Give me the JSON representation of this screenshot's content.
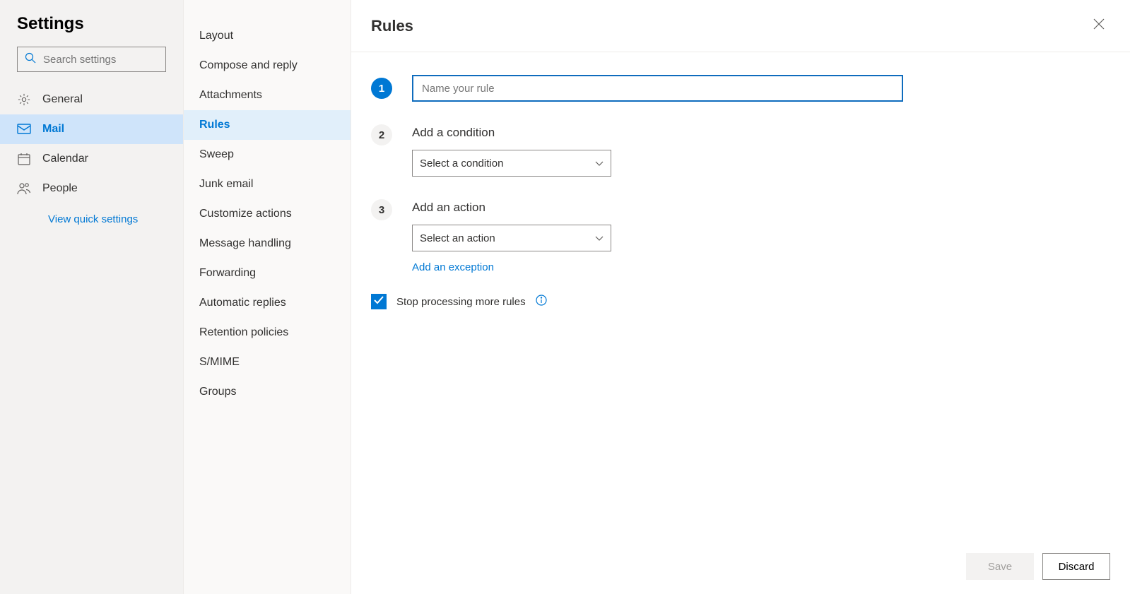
{
  "sidebar": {
    "title": "Settings",
    "search_placeholder": "Search settings",
    "items": [
      {
        "label": "General"
      },
      {
        "label": "Mail"
      },
      {
        "label": "Calendar"
      },
      {
        "label": "People"
      }
    ],
    "quick_link": "View quick settings"
  },
  "midbar": {
    "items": [
      {
        "label": "Layout"
      },
      {
        "label": "Compose and reply"
      },
      {
        "label": "Attachments"
      },
      {
        "label": "Rules"
      },
      {
        "label": "Sweep"
      },
      {
        "label": "Junk email"
      },
      {
        "label": "Customize actions"
      },
      {
        "label": "Message handling"
      },
      {
        "label": "Forwarding"
      },
      {
        "label": "Automatic replies"
      },
      {
        "label": "Retention policies"
      },
      {
        "label": "S/MIME"
      },
      {
        "label": "Groups"
      }
    ],
    "selected_index": 3
  },
  "main": {
    "title": "Rules",
    "steps": {
      "one": {
        "num": "1",
        "input_placeholder": "Name your rule",
        "input_value": ""
      },
      "two": {
        "num": "2",
        "title": "Add a condition",
        "dropdown": "Select a condition"
      },
      "three": {
        "num": "3",
        "title": "Add an action",
        "dropdown": "Select an action",
        "exception_link": "Add an exception"
      }
    },
    "checkbox_label": "Stop processing more rules",
    "checkbox_checked": true,
    "footer": {
      "save": "Save",
      "discard": "Discard"
    }
  }
}
